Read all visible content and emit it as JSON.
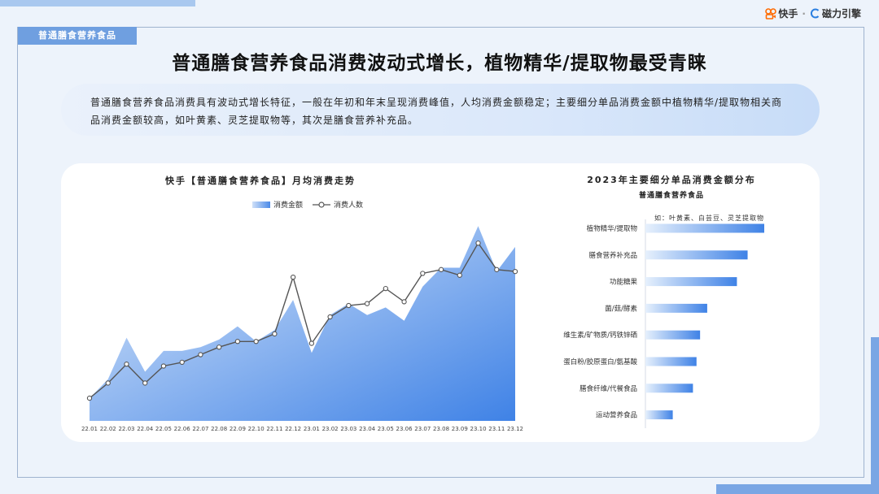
{
  "brand": {
    "kuaishou": "快手",
    "separator": "·",
    "engine": "磁力引擎"
  },
  "section_tag": "普通膳食营养食品",
  "headline": "普通膳食营养食品消费波动式增长，植物精华/提取物最受青睐",
  "summary": "普通膳食营养食品消费具有波动式增长特征，一般在年初和年末呈现消费峰值，人均消费金额稳定；主要细分单品消费金额中植物精华/提取物相关商品消费金额较高，如叶黄素、灵芝提取物等，其次是膳食营养补充品。",
  "colors": {
    "accent": "#6f9fe0",
    "area_top": "#3f82e6",
    "area_bottom": "#dce9fa",
    "line": "#555555"
  },
  "chart_data": [
    {
      "type": "area",
      "title": "快手【普通膳食营养食品】月均消费走势",
      "x": [
        "22.01",
        "22.02",
        "22.03",
        "22.04",
        "22.05",
        "22.06",
        "22.07",
        "22.08",
        "22.09",
        "22.10",
        "22.11",
        "22.12",
        "23.01",
        "23.02",
        "23.03",
        "23.04",
        "23.05",
        "23.06",
        "23.07",
        "23.08",
        "23.09",
        "23.10",
        "23.11",
        "23.12"
      ],
      "series": [
        {
          "name": "消费金额",
          "style": "area",
          "values": [
            12,
            22,
            44,
            26,
            37,
            37,
            39,
            43,
            50,
            42,
            48,
            64,
            36,
            56,
            62,
            56,
            60,
            53,
            71,
            81,
            81,
            103,
            79,
            92
          ]
        },
        {
          "name": "消费人数",
          "style": "line",
          "values": [
            12,
            20,
            30,
            20,
            29,
            31,
            35,
            39,
            42,
            42,
            46,
            76,
            41,
            55,
            61,
            62,
            70,
            63,
            78,
            80,
            77,
            94,
            80,
            79
          ]
        }
      ],
      "ylim": [
        0,
        110
      ],
      "grid": false,
      "legend": "top-center"
    },
    {
      "type": "bar",
      "orientation": "horizontal",
      "title": "2023年主要细分单品消费金额分布",
      "subtitle": "普通膳食营养食品",
      "annotation": "如：叶黄素、白芸豆、灵芝提取物",
      "categories": [
        "植物精华/提取物",
        "膳食营养补充品",
        "功能糖果",
        "菌/菇/酵素",
        "维生素/矿物质/钙铁锌硒",
        "蛋白粉/胶原蛋白/氨基酸",
        "膳食纤维/代餐食品",
        "运动营养食品"
      ],
      "values": [
        100,
        86,
        77,
        52,
        46,
        43,
        40,
        23
      ],
      "xlim": [
        0,
        100
      ]
    }
  ]
}
